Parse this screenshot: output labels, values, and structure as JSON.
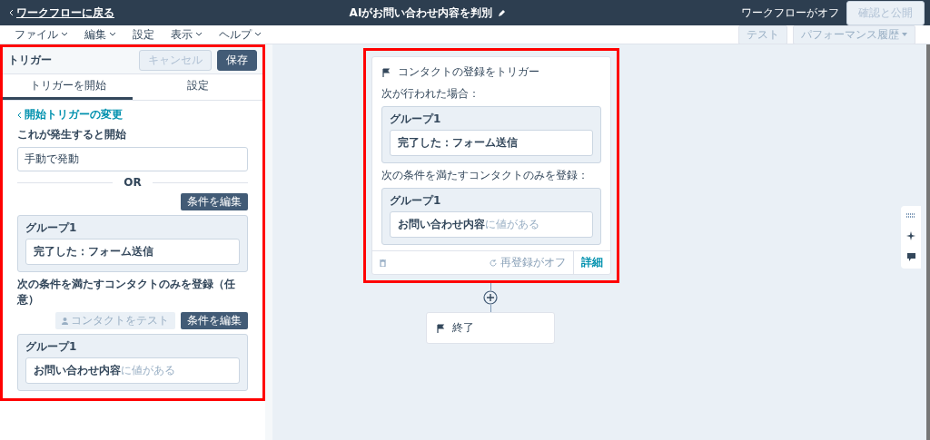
{
  "header": {
    "back_link": "ワークフローに戻る",
    "title": "AIがお問い合わせ内容を判別",
    "status": "ワークフローがオフ",
    "publish_button": {
      "label": "確認と公開",
      "disabled": true
    }
  },
  "menu": [
    {
      "label": "ファイル",
      "dropdown": true
    },
    {
      "label": "編集",
      "dropdown": true
    },
    {
      "label": "設定",
      "dropdown": false
    },
    {
      "label": "表示",
      "dropdown": true
    },
    {
      "label": "ヘルプ",
      "dropdown": true
    }
  ],
  "toolbar_buttons": [
    {
      "label": "テスト",
      "dropdown": false
    },
    {
      "label": "パフォーマンス履歴",
      "dropdown": true
    }
  ],
  "panel": {
    "title": "トリガー",
    "cancel_button": {
      "label": "キャンセル",
      "disabled": true
    },
    "save_button": {
      "label": "保存",
      "disabled": false
    },
    "tabs": [
      {
        "label": "トリガーを開始",
        "selected": true
      },
      {
        "label": "設定",
        "selected": false
      }
    ],
    "change_link": "開始トリガーの変更",
    "start_heading": "これが発生すると開始",
    "manual_field": "手動で発動",
    "or_divider": "OR",
    "edit_button": "条件を編集",
    "group": {
      "title": "グループ1",
      "conditions": [
        {
          "text": "完了した：フォーム送信"
        }
      ]
    },
    "enroll_heading": "次の条件を満たすコンタクトのみを登録（任意）",
    "test_button": "コンタクトをテスト",
    "enroll_edit_button": "条件を編集",
    "enroll_group": {
      "title": "グループ1",
      "conditions": [
        {
          "text": "お問い合わせ内容",
          "detail": "に値がある"
        }
      ]
    }
  },
  "canvas": {
    "trigger_card": {
      "title": "コンタクトの登録をトリガー",
      "when_label": "次が行われた場合：",
      "group": {
        "title": "グループ1",
        "conditions": [
          {
            "text": "完了した：フォーム送信"
          }
        ]
      },
      "enroll_label": "次の条件を満たすコンタクトのみを登録：",
      "enroll_group": {
        "title": "グループ1",
        "conditions": [
          {
            "text": "お問い合わせ内容",
            "detail": "に値がある"
          }
        ]
      },
      "reenroll": "再登録がオフ",
      "details_link": "詳細"
    },
    "end_node": "終了"
  }
}
